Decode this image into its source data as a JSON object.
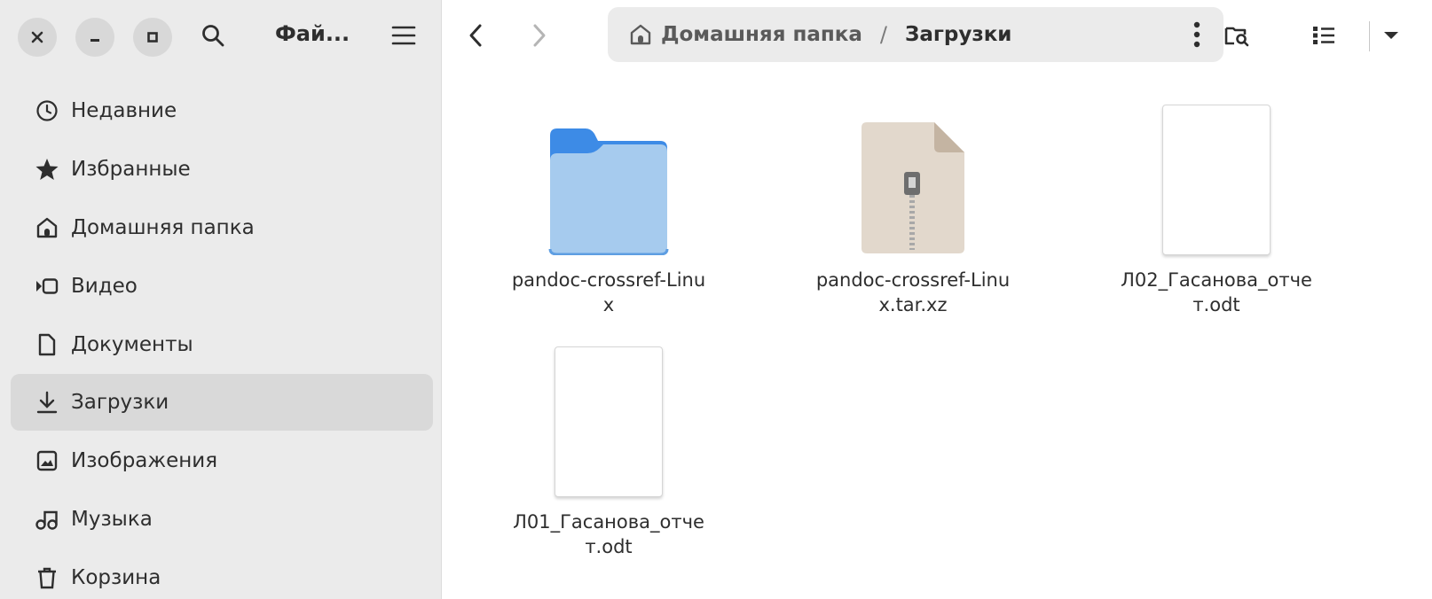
{
  "app": {
    "title": "Фай...",
    "colors": {
      "sidebar_bg": "#ebebeb",
      "selected_bg": "#d9d9d9",
      "folder_blue": "#3d8be6",
      "folder_light": "#a6cbee"
    }
  },
  "window_controls": {
    "close_icon": "close-icon",
    "minimize_icon": "minimize-icon",
    "maximize_icon": "maximize-icon"
  },
  "header": {
    "search_icon": "search-icon",
    "menu_icon": "hamburger-menu-icon"
  },
  "sidebar": {
    "items": [
      {
        "label": "Недавние",
        "icon": "clock-icon",
        "selected": false
      },
      {
        "label": "Избранные",
        "icon": "star-icon",
        "selected": false
      },
      {
        "label": "Домашняя папка",
        "icon": "home-icon",
        "selected": false
      },
      {
        "label": "Видео",
        "icon": "video-icon",
        "selected": false
      },
      {
        "label": "Документы",
        "icon": "document-icon",
        "selected": false
      },
      {
        "label": "Загрузки",
        "icon": "download-icon",
        "selected": true
      },
      {
        "label": "Изображения",
        "icon": "image-icon",
        "selected": false
      },
      {
        "label": "Музыка",
        "icon": "music-icon",
        "selected": false
      },
      {
        "label": "Корзина",
        "icon": "trash-icon",
        "selected": false
      }
    ]
  },
  "toolbar": {
    "back_icon": "chevron-left-icon",
    "forward_icon": "chevron-right-icon",
    "path": {
      "home_label": "Домашняя папка",
      "separator": "/",
      "current_label": "Загрузки",
      "menu_icon": "vertical-dots-icon"
    },
    "search_folder_icon": "folder-search-icon",
    "view_icon": "list-view-icon",
    "view_dropdown_icon": "dropdown-arrow-icon"
  },
  "files": [
    {
      "name": "pandoc-crossref-Linux",
      "kind": "folder"
    },
    {
      "name": "pandoc-crossref-Linux.tar.xz",
      "kind": "archive"
    },
    {
      "name": "Л02_Гасанова_отчет.odt",
      "kind": "document"
    },
    {
      "name": "Л01_Гасанова_отчет.odt",
      "kind": "document"
    }
  ]
}
